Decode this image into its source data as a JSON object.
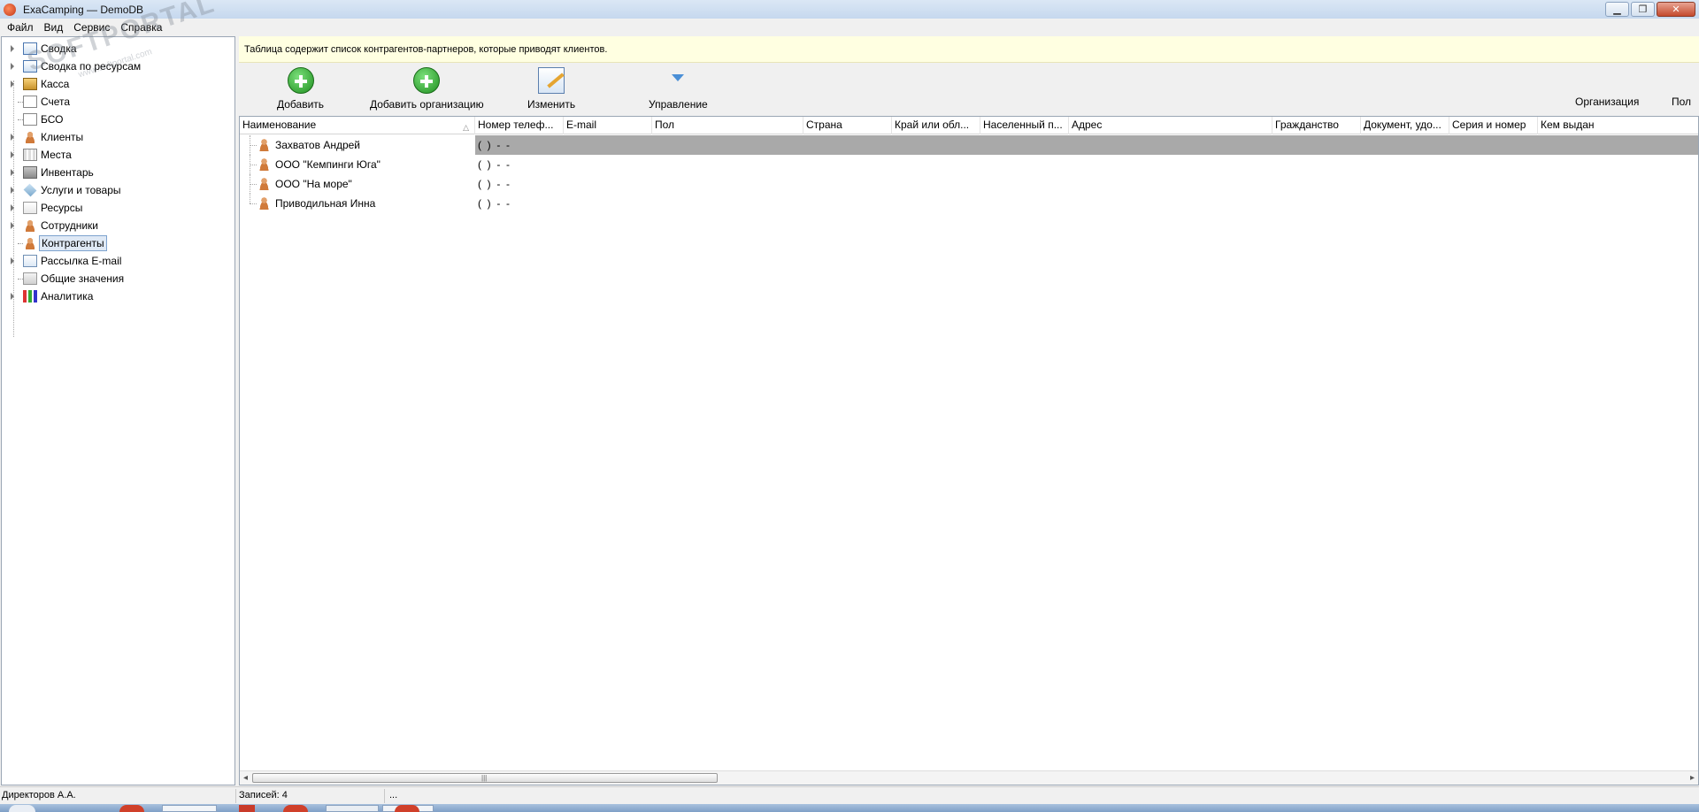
{
  "window": {
    "title": "ExaCamping — DemoDB"
  },
  "menu": [
    "Файл",
    "Вид",
    "Сервис",
    "Справка"
  ],
  "watermark": {
    "main": "SOFTPORTAL",
    "sub": "www.softportal.com",
    "mark": "TM"
  },
  "sidebar": {
    "items": [
      {
        "label": "Сводка",
        "icon": "grid-icon"
      },
      {
        "label": "Сводка по ресурсам",
        "icon": "grid-icon"
      },
      {
        "label": "Касса",
        "icon": "cash-box-icon"
      },
      {
        "label": "Счета",
        "icon": "document-icon"
      },
      {
        "label": "БСО",
        "icon": "document-icon"
      },
      {
        "label": "Клиенты",
        "icon": "person-icon"
      },
      {
        "label": "Места",
        "icon": "places-icon"
      },
      {
        "label": "Инвентарь",
        "icon": "inventory-icon"
      },
      {
        "label": "Услуги и товары",
        "icon": "diamond-icon"
      },
      {
        "label": "Ресурсы",
        "icon": "resources-icon"
      },
      {
        "label": "Сотрудники",
        "icon": "person-icon"
      },
      {
        "label": "Контрагенты",
        "icon": "person-icon",
        "selected": true
      },
      {
        "label": "Рассылка E-mail",
        "icon": "mail-icon"
      },
      {
        "label": "Общие значения",
        "icon": "common-values-icon"
      },
      {
        "label": "Аналитика",
        "icon": "chart-icon"
      }
    ]
  },
  "info": {
    "text": "Таблица содержит список контрагентов-партнеров, которые приводят клиентов."
  },
  "toolbar": {
    "add_label": "Добавить",
    "add_org_label": "Добавить организацию",
    "edit_label": "Изменить",
    "manage_label": "Управление",
    "org_label": "Организация",
    "gender_label": "Пол"
  },
  "table": {
    "columns": [
      "Наименование",
      "Номер телеф...",
      "E-mail",
      "Пол",
      "Страна",
      "Край или обл...",
      "Населенный п...",
      "Адрес",
      "Гражданство",
      "Документ, удо...",
      "Серия и номер",
      "Кем выдан"
    ],
    "rows": [
      {
        "name": "Захватов Андрей",
        "phone": "(  )  -  -",
        "selected": true
      },
      {
        "name": "ООО \"Кемпинги Юга\"",
        "phone": "(  )  -  -"
      },
      {
        "name": "ООО \"На море\"",
        "phone": "(  )  -  -"
      },
      {
        "name": "Приводильная Инна",
        "phone": "(  )  -  -"
      }
    ]
  },
  "status": {
    "user": "Директоров А.А.",
    "records": "Записей: 4",
    "extra": "..."
  },
  "colors": {
    "selected_row": "#a9a9a9",
    "info_bg": "#ffffe1",
    "selected_item_border": "#7da2ce"
  }
}
